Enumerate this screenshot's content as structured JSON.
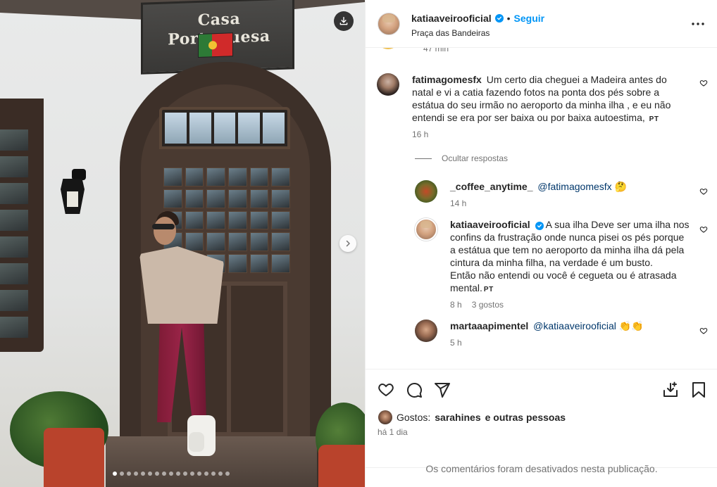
{
  "photo": {
    "sign_text": "Casa Portuguesa",
    "download_icon": "download-icon",
    "next_icon": "chevron-right-icon",
    "carousel": {
      "total": 17,
      "current": 1
    }
  },
  "header": {
    "username": "katiaaveirooficial",
    "verified": true,
    "separator": "•",
    "follow_label": "Seguir",
    "location": "Praça das Bandeiras",
    "more_icon": "more-horizontal-icon"
  },
  "comments": {
    "cut_time": "47 min",
    "items": [
      {
        "username": "fatimagomesfx",
        "text": "Um certo dia cheguei a Madeira antes do natal e vi a catia fazendo fotos na ponta dos pés sobre a estátua do seu irmão no aeroporto da minha ilha , e eu não entendi se era por ser baixa ou por baixa autoestima,",
        "tag": "PT",
        "time": "16 h"
      }
    ],
    "hide_replies_label": "Ocultar respostas",
    "replies": [
      {
        "username": "_coffee_anytime_",
        "mention": "@fatimagomesfx",
        "text": " 🤔",
        "time": "14 h"
      },
      {
        "username": "katiaaveirooficial",
        "verified": true,
        "line1": "A sua ilha Deve ser uma ilha nos",
        "line2": "confins da frustração onde nunca pisei os pés porque",
        "line3": "a estátua que tem no aeroporto da minha ilha dá pela",
        "line4": "cintura da minha filha, na verdade é um busto.",
        "line5": "Então não entendi ou você é cegueta ou é atrasada",
        "line6": "mental.",
        "tag": "PT",
        "time": "8 h",
        "likes": "3 gostos"
      },
      {
        "username": "martaaapimentel",
        "mention": "@katiaaveirooficial",
        "text": " 👏👏",
        "time": "5 h"
      }
    ]
  },
  "actions": {
    "like_icon": "heart-icon",
    "comment_icon": "comment-icon",
    "share_icon": "send-icon",
    "save_to_icon": "download-tray-icon",
    "bookmark_icon": "bookmark-icon",
    "likes_prefix": "Gostos:",
    "likes_user": "sarahines",
    "likes_suffix": "e outras pessoas",
    "time_ago": "há 1 dia"
  },
  "footer": {
    "comments_disabled": "Os comentários foram desativados nesta publicação."
  },
  "colors": {
    "link_blue": "#0095f6",
    "mention_blue": "#00376b",
    "muted": "#737373",
    "text": "#262626"
  }
}
